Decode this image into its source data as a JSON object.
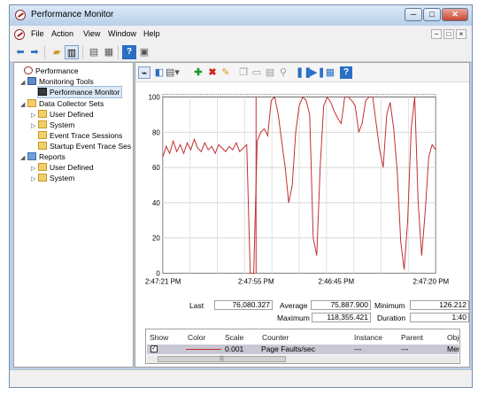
{
  "window": {
    "title": "Performance Monitor",
    "min": "─",
    "max": "□",
    "close": "✕"
  },
  "menu": [
    "File",
    "Action",
    "View",
    "Window",
    "Help"
  ],
  "mdi_buttons": [
    "−",
    "□",
    "×"
  ],
  "tree": [
    {
      "label": "Performance",
      "icon": "perf",
      "exp": ""
    },
    {
      "label": "Monitoring Tools",
      "icon": "tools",
      "exp": "◢"
    },
    {
      "label": "Performance Monitor",
      "icon": "monitor",
      "exp": ""
    },
    {
      "label": "Data Collector Sets",
      "icon": "folder",
      "exp": "◢"
    },
    {
      "label": "User Defined",
      "icon": "folder",
      "exp": "▷"
    },
    {
      "label": "System",
      "icon": "folder",
      "exp": "▷"
    },
    {
      "label": "Event Trace Sessions",
      "icon": "folder",
      "exp": ""
    },
    {
      "label": "Startup Event Trace Ses",
      "icon": "folder",
      "exp": ""
    },
    {
      "label": "Reports",
      "icon": "report",
      "exp": "◢"
    },
    {
      "label": "User Defined",
      "icon": "folder",
      "exp": "▷"
    },
    {
      "label": "System",
      "icon": "folder",
      "exp": "▷"
    }
  ],
  "chart_data": {
    "type": "line",
    "series": [
      {
        "color": "#c03030",
        "values": [
          66,
          72,
          68,
          75,
          69,
          73,
          68,
          74,
          70,
          76,
          71,
          69,
          74,
          70,
          72,
          68,
          73,
          71,
          69,
          72,
          70,
          74,
          69,
          71,
          73,
          0,
          0,
          75,
          80,
          82,
          78,
          98,
          100,
          90,
          75,
          60,
          40,
          50,
          80,
          95,
          100,
          98,
          90,
          20,
          10,
          60,
          95,
          100,
          97,
          92,
          88,
          85,
          100,
          100,
          98,
          95,
          80,
          85,
          98,
          100,
          100,
          85,
          70,
          60,
          90,
          97,
          82,
          58,
          18,
          2,
          30,
          82,
          100,
          40,
          10,
          35,
          66,
          73,
          70
        ]
      }
    ],
    "x": [
      "2:47:21 PM",
      "2:47:55 PM",
      "2:46:45 PM",
      "2:47:20 PM"
    ],
    "ylim": [
      0,
      100
    ],
    "yticks": [
      "100",
      "80",
      "60",
      "40",
      "20",
      "0"
    ]
  },
  "stats": {
    "last_label": "Last",
    "last": "76,080.327",
    "avg_label": "Average",
    "avg": "75,887.900",
    "min_label": "Minimum",
    "min": "126.212",
    "max_label": "Maximum",
    "max": "118,355.421",
    "dur_label": "Duration",
    "dur": "1:40"
  },
  "legend": {
    "headers": [
      "Show",
      "Color",
      "Scale",
      "Counter",
      "Instance",
      "Parent",
      "Objec"
    ],
    "row": {
      "scale": "0.001",
      "counter": "Page Faults/sec",
      "instance": "---",
      "parent": "---",
      "object": "Mem"
    }
  }
}
